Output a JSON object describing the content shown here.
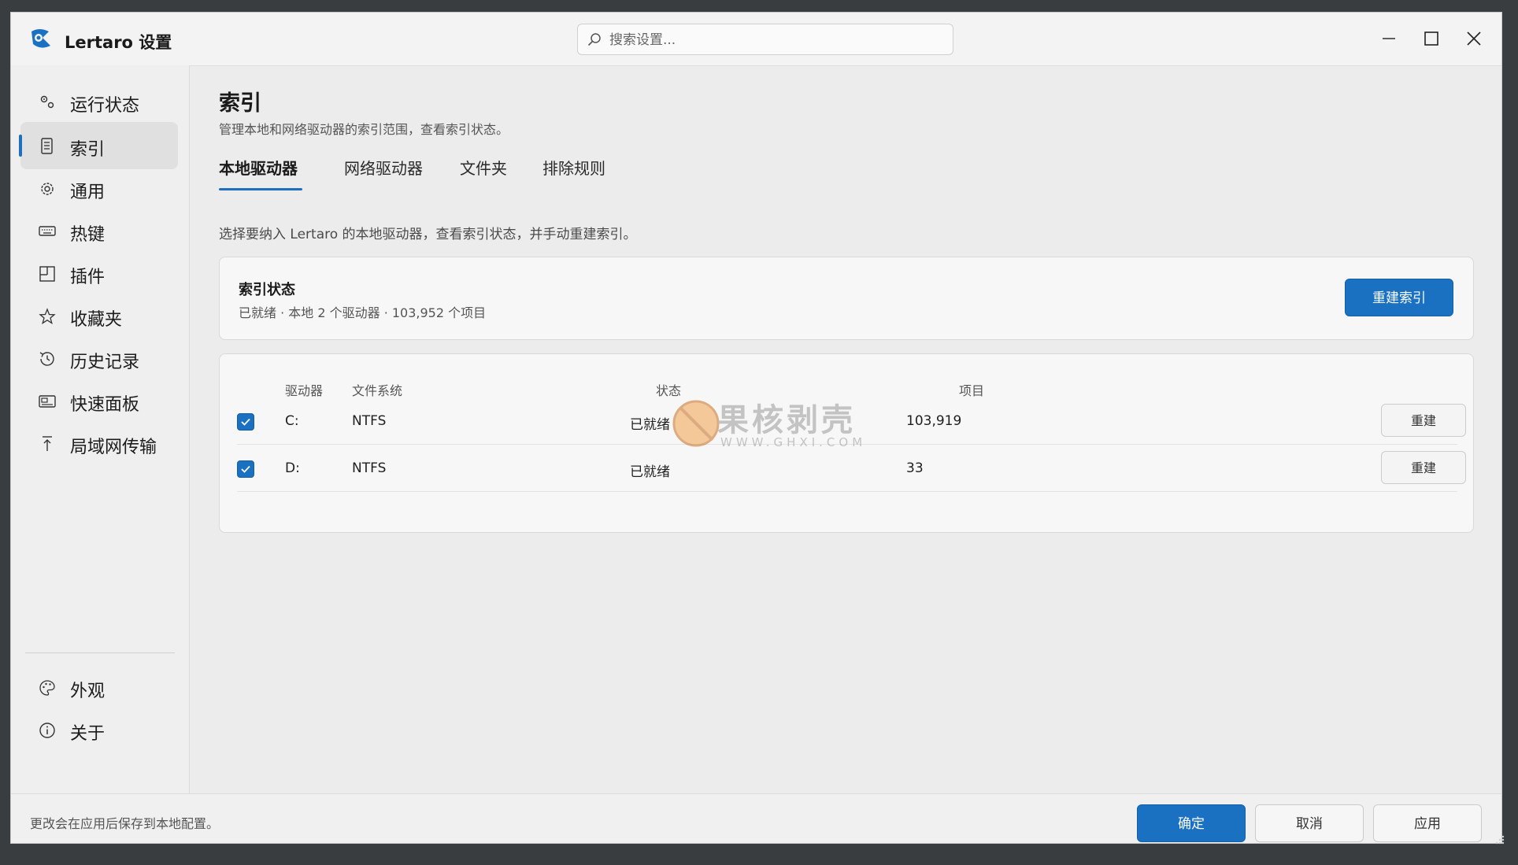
{
  "window": {
    "title": "Lertaro 设置",
    "search_placeholder": "搜索设置..."
  },
  "sidebar": {
    "items": [
      {
        "label": "运行状态",
        "icon": "gears-icon"
      },
      {
        "label": "索引",
        "icon": "index-icon",
        "active": true
      },
      {
        "label": "通用",
        "icon": "gear-icon"
      },
      {
        "label": "热键",
        "icon": "keyboard-icon"
      },
      {
        "label": "插件",
        "icon": "plugin-icon"
      },
      {
        "label": "收藏夹",
        "icon": "star-icon"
      },
      {
        "label": "历史记录",
        "icon": "history-icon"
      },
      {
        "label": "快速面板",
        "icon": "panel-icon"
      },
      {
        "label": "局域网传输",
        "icon": "upload-icon"
      }
    ],
    "bottom_items": [
      {
        "label": "外观",
        "icon": "palette-icon"
      },
      {
        "label": "关于",
        "icon": "info-icon"
      }
    ]
  },
  "main": {
    "title": "索引",
    "description": "管理本地和网络驱动器的索引范围，查看索引状态。",
    "tabs": [
      {
        "label": "本地驱动器",
        "active": true
      },
      {
        "label": "网络驱动器"
      },
      {
        "label": "文件夹"
      },
      {
        "label": "排除规则"
      }
    ],
    "section_description": "选择要纳入 Lertaro 的本地驱动器，查看索引状态，并手动重建索引。",
    "status_card": {
      "title": "索引状态",
      "summary": "已就绪 · 本地 2 个驱动器 · 103,952 个项目",
      "rebuild_label": "重建索引"
    },
    "drive_table": {
      "columns": [
        "驱动器",
        "文件系统",
        "状态",
        "项目"
      ],
      "rows": [
        {
          "drive": "C:",
          "fs": "NTFS",
          "status": "已就绪",
          "items": "103,919",
          "checked": true,
          "action": "重建"
        },
        {
          "drive": "D:",
          "fs": "NTFS",
          "status": "已就绪",
          "items": "33",
          "checked": true,
          "action": "重建"
        }
      ]
    }
  },
  "watermark": {
    "text": "果核剥壳",
    "url": "WWW.GHXI.COM"
  },
  "footer": {
    "note": "更改会在应用后保存到本地配置。",
    "ok_label": "确定",
    "cancel_label": "取消",
    "apply_label": "应用"
  },
  "colors": {
    "accent": "#1a71c2",
    "window_bg": "#ececec",
    "card_bg": "#f7f7f7"
  }
}
